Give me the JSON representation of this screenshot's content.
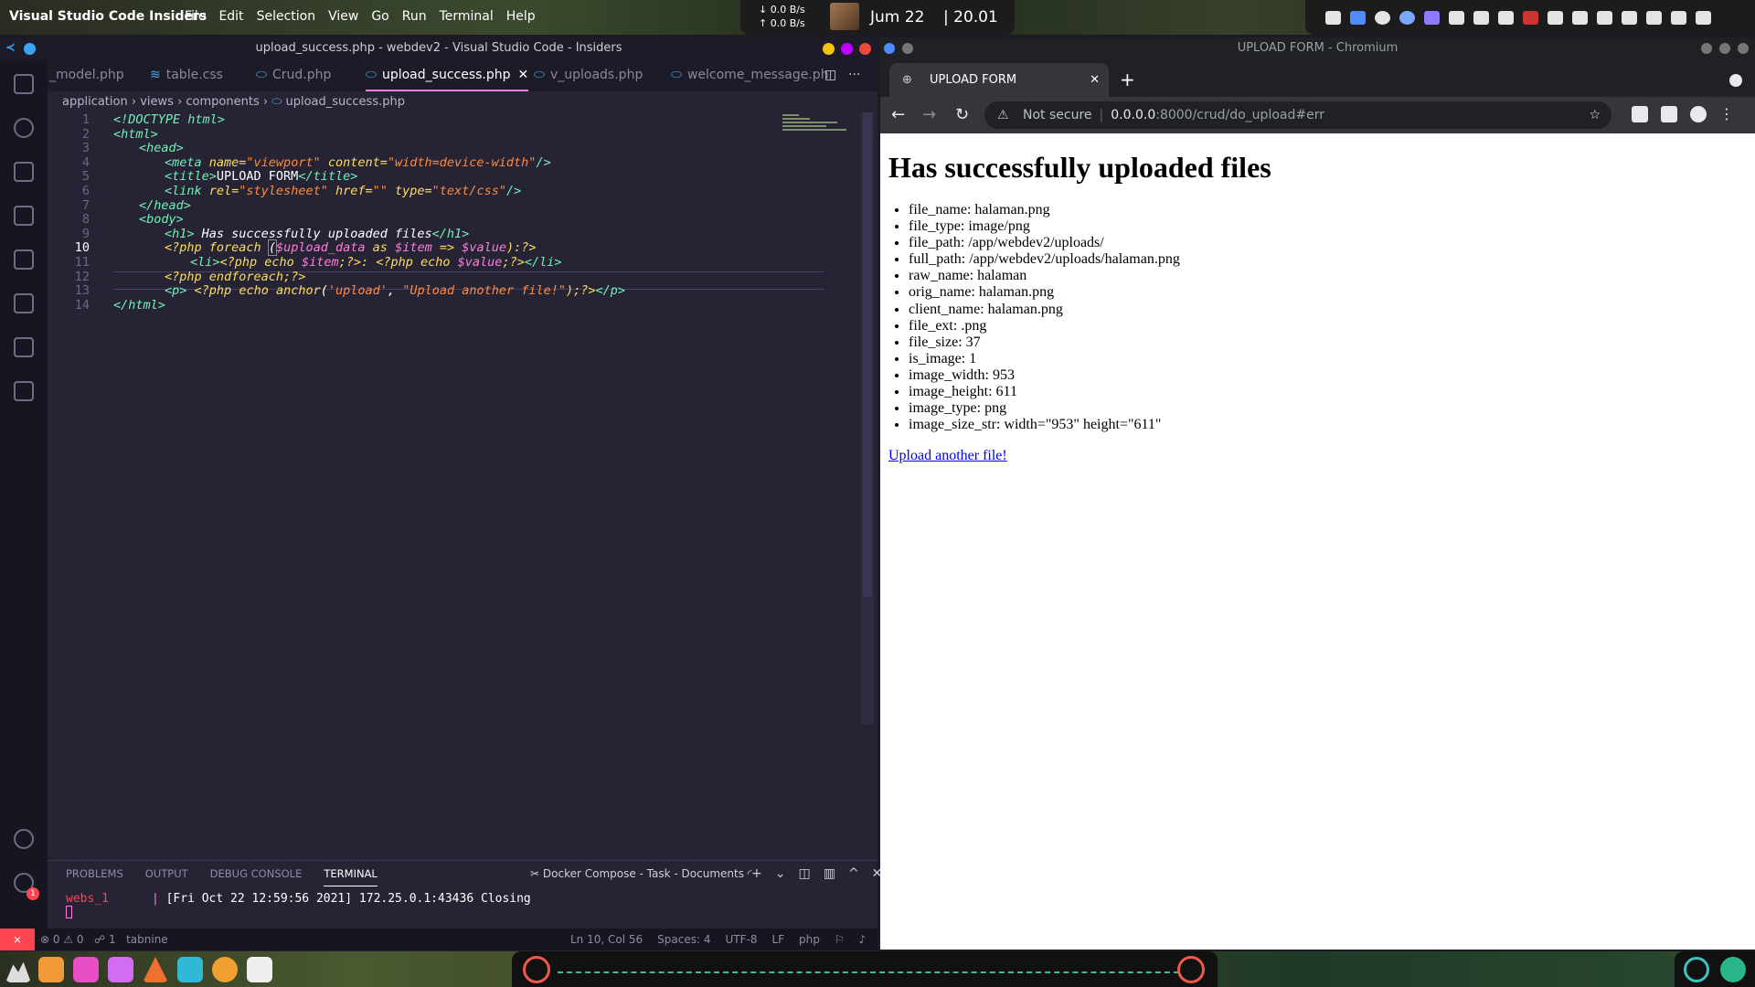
{
  "system": {
    "app_name": "Visual Studio Code Insiders",
    "menus": [
      "File",
      "Edit",
      "Selection",
      "View",
      "Go",
      "Run",
      "Terminal",
      "Help"
    ],
    "net_down": "0.0 B/s",
    "net_up": "0.0 B/s",
    "date": "Jum  22",
    "time": "| 20.01"
  },
  "vscode": {
    "window_title": "upload_success.php - webdev2 - Visual Studio Code - Insiders",
    "tabs": [
      {
        "label": "_model.php",
        "icon": "php-file-icon"
      },
      {
        "label": "table.css",
        "icon": "css-file-icon"
      },
      {
        "label": "Crud.php",
        "icon": "php-file-icon"
      },
      {
        "label": "upload_success.php",
        "icon": "php-file-icon",
        "active": true
      },
      {
        "label": "v_uploads.php",
        "icon": "php-file-icon"
      },
      {
        "label": "welcome_message.ph",
        "icon": "php-file-icon"
      }
    ],
    "breadcrumb": [
      "application",
      "views",
      "components",
      "upload_success.php"
    ],
    "line_numbers": [
      "1",
      "2",
      "3",
      "4",
      "5",
      "6",
      "7",
      "8",
      "9",
      "10",
      "11",
      "12",
      "13",
      "14"
    ],
    "current_line": 10,
    "code": {
      "l1": "<!DOCTYPE html>",
      "l2": "<html>",
      "l3": "<head>",
      "l4_tag": "<meta",
      "l4_attr1": "name=",
      "l4_val1": "\"viewport\"",
      "l4_attr2": "content=",
      "l4_val2": "\"width=device-width\"",
      "l4_end": "/>",
      "l5_open": "<title>",
      "l5_text": "UPLOAD FORM",
      "l5_close": "</title>",
      "l6_tag": "<link",
      "l6_attr1": "rel=",
      "l6_val1": "\"stylesheet\"",
      "l6_attr2": "href=",
      "l6_val2": "\"\"",
      "l6_attr3": "type=",
      "l6_val3": "\"text/css\"",
      "l6_end": "/>",
      "l7": "</head>",
      "l8": "<body>",
      "l9_open": "<h1>",
      "l9_text": " Has successfully uploaded files",
      "l9_close": "</h1>",
      "l10_php": "<?php",
      "l10_kw": "foreach",
      "l10_paren": "(",
      "l10_var1": "$upload_data",
      "l10_as": "as",
      "l10_var2": "$item",
      "l10_arrow": "=>",
      "l10_var3": "$value",
      "l10_end": "):?>",
      "l11_li": "<li>",
      "l11_php1": "<?php",
      "l11_echo1": "echo",
      "l11_var1": "$item",
      "l11_mid": ";?>: ",
      "l11_php2": "<?php",
      "l11_echo2": "echo",
      "l11_var2": "$value",
      "l11_end": ";?>",
      "l11_li_close": "</li>",
      "l12": "<?php endforeach;?>",
      "l13_p": "<p>",
      "l13_php": "<?php",
      "l13_echo": "echo",
      "l13_fn": "anchor",
      "l13_open": "(",
      "l13_arg1": "'upload'",
      "l13_comma": ", ",
      "l13_arg2": "\"Upload another file!\"",
      "l13_end": ");?>",
      "l13_p_close": "</p>",
      "l14": "</html>"
    },
    "panel": {
      "tabs": [
        "PROBLEMS",
        "OUTPUT",
        "DEBUG CONSOLE",
        "TERMINAL"
      ],
      "active_tab": "TERMINAL",
      "task_label": "Docker Compose - Task - Documents",
      "terminal_service": "webs_1",
      "terminal_sep": "|",
      "terminal_line": "[Fri Oct 22 12:59:56 2021] 172.25.0.1:43436 Closing"
    },
    "status": {
      "errors": "⊗ 0",
      "warnings": "⚠ 0",
      "ports": "☍ 1",
      "tabnine": "tabnine",
      "position": "Ln 10, Col 56",
      "spaces": "Spaces: 4",
      "encoding": "UTF-8",
      "eol": "LF",
      "language": "php"
    },
    "settings_badge": "1"
  },
  "chromium": {
    "window_title": "UPLOAD FORM - Chromium",
    "tab_title": "UPLOAD FORM",
    "url_warning": "Not secure",
    "url_host": "0.0.0.0",
    "url_path": ":8000/crud/do_upload#err",
    "page": {
      "heading": "Has successfully uploaded files",
      "items": [
        "file_name: halaman.png",
        "file_type: image/png",
        "file_path: /app/webdev2/uploads/",
        "full_path: /app/webdev2/uploads/halaman.png",
        "raw_name: halaman",
        "orig_name: halaman.png",
        "client_name: halaman.png",
        "file_ext: .png",
        "file_size: 37",
        "is_image: 1",
        "image_width: 953",
        "image_height: 611",
        "image_type: png",
        "image_size_str: width=\"953\" height=\"611\""
      ],
      "link_text": "Upload another file!"
    }
  },
  "colors": {
    "editor_bg": "#262335",
    "tag": "#72f1b8",
    "attr": "#fede5d",
    "string": "#ff8b39",
    "variable": "#ff7edb",
    "remote": "#fe4450",
    "link": "#0000ee"
  }
}
